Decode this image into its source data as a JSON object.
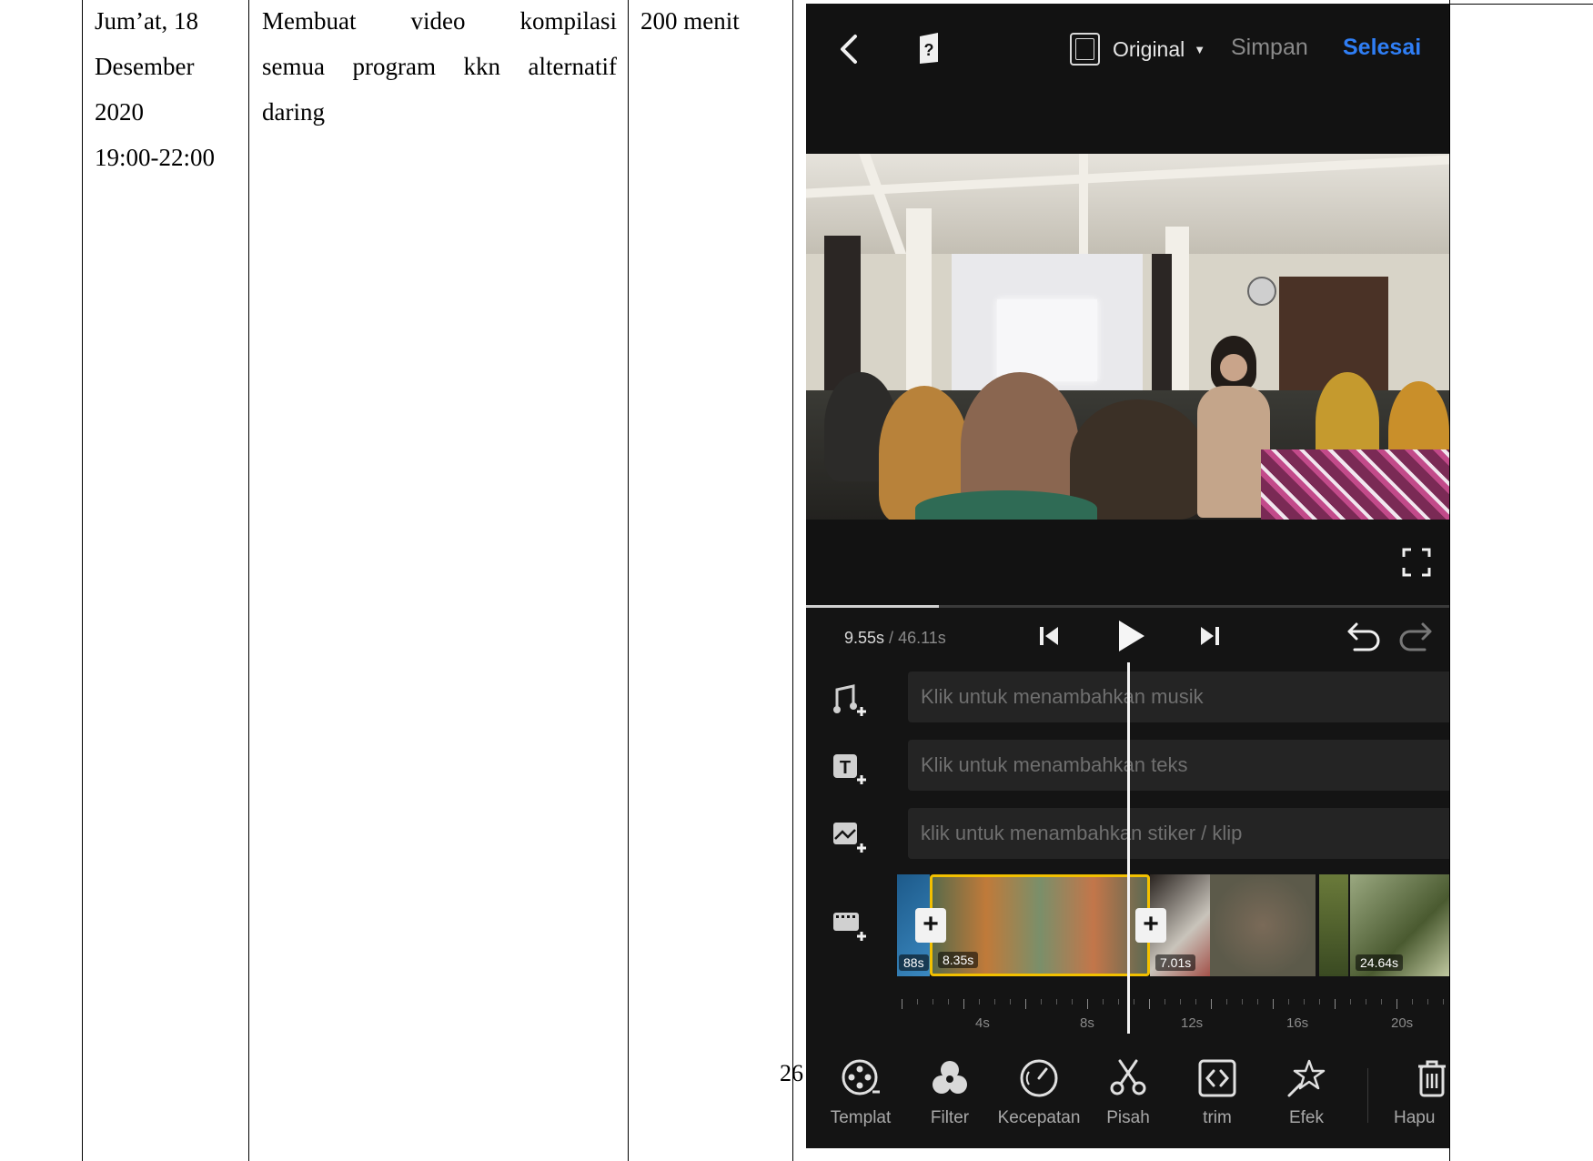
{
  "document": {
    "date_cell": [
      "Jum’at, 18",
      "Desember",
      "2020",
      "19:00-22:00"
    ],
    "activity_line1": [
      "Membuat",
      "video",
      "kompilasi"
    ],
    "activity_line2": [
      "semua",
      "program",
      "kkn",
      "alternatif"
    ],
    "activity_line3": "daring",
    "duration": "200 menit",
    "page_number": "26"
  },
  "app": {
    "topbar": {
      "aspect_label": "Original",
      "save_label": "Simpan",
      "done_label": "Selesai"
    },
    "playback": {
      "current_time": "9.55s",
      "separator": " / ",
      "total_time": "46.11s",
      "progress_fraction": 0.207
    },
    "tracks": {
      "music_hint": "Klik untuk menambahkan musik",
      "text_hint": "Klik untuk menambahkan teks",
      "sticker_hint": "klik untuk menambahkan stiker / klip"
    },
    "clips": {
      "prev_label": "88s",
      "selected_label": "8.35s",
      "next_label": "7.01s",
      "last_label": "24.64s"
    },
    "ruler_labels": [
      "4s",
      "8s",
      "12s",
      "16s",
      "20s"
    ],
    "tools": [
      "Templat",
      "Filter",
      "Kecepatan",
      "Pisah",
      "trim",
      "Efek",
      "Hapu"
    ],
    "colors": {
      "accent_blue": "#2f7ef5",
      "selection_yellow": "#f2c000",
      "background": "#141414"
    }
  }
}
